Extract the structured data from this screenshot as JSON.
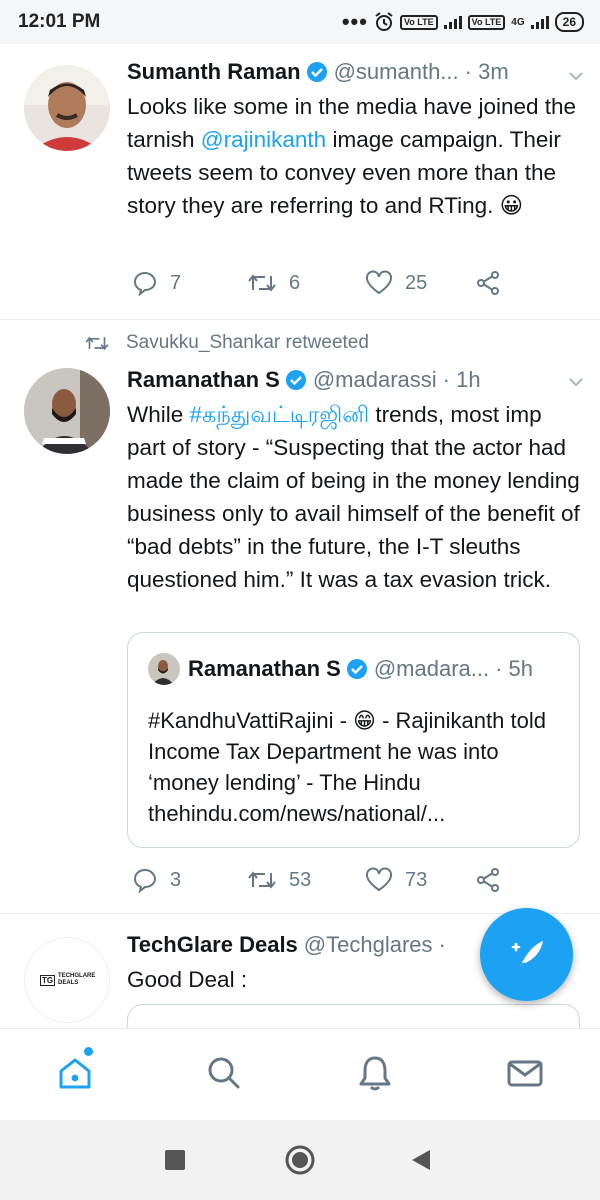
{
  "status_bar": {
    "time": "12:01 PM",
    "network_1": "Vo LTE",
    "network_2": "Vo LTE",
    "network_type": "4G",
    "battery": "26"
  },
  "tweets": [
    {
      "name": "Sumanth Raman",
      "handle": "@sumanth...",
      "time": "· 3m",
      "text_parts": [
        "Looks like some in the media have joined the tarnish ",
        "@rajinikanth",
        "  image campaign. Their tweets seem to convey even more than the story they are referring to and RTing. 😀"
      ],
      "replies": "7",
      "retweets": "6",
      "likes": "25"
    },
    {
      "retweeted_by": "Savukku_Shankar retweeted",
      "name": "Ramanathan S",
      "handle": "@madarassi",
      "time": "· 1h",
      "text_parts": [
        "While ",
        "#கந்துவட்டிரஜினி",
        " trends, most imp part of story - “Suspecting that the actor had made the claim of being in the money lending business only to avail himself of the benefit of “bad debts” in the future, the I-T sleuths questioned him.” It was a tax evasion trick."
      ],
      "quote": {
        "name": "Ramanathan S",
        "handle": "@madara...",
        "time": "· 5h",
        "text": "#KandhuVattiRajini - 😁 - Rajinikanth told Income Tax Department he was into ‘money lending’ - The Hindu thehindu.com/news/national/..."
      },
      "replies": "3",
      "retweets": "53",
      "likes": "73"
    },
    {
      "name": "TechGlare Deals",
      "handle": "@Techglares",
      "time": "·",
      "text": "Good Deal :",
      "avatar_text": "TECHGLARE DEALS",
      "avatar_mark": "TG"
    }
  ],
  "colors": {
    "accent": "#1da1f2",
    "text": "#14171a",
    "muted": "#657786"
  },
  "icons": [
    "home-icon",
    "search-icon",
    "notifications-icon",
    "messages-icon",
    "compose-tweet-icon",
    "verified-icon",
    "reply-icon",
    "retweet-icon",
    "like-icon",
    "share-icon",
    "caret-down-icon"
  ]
}
